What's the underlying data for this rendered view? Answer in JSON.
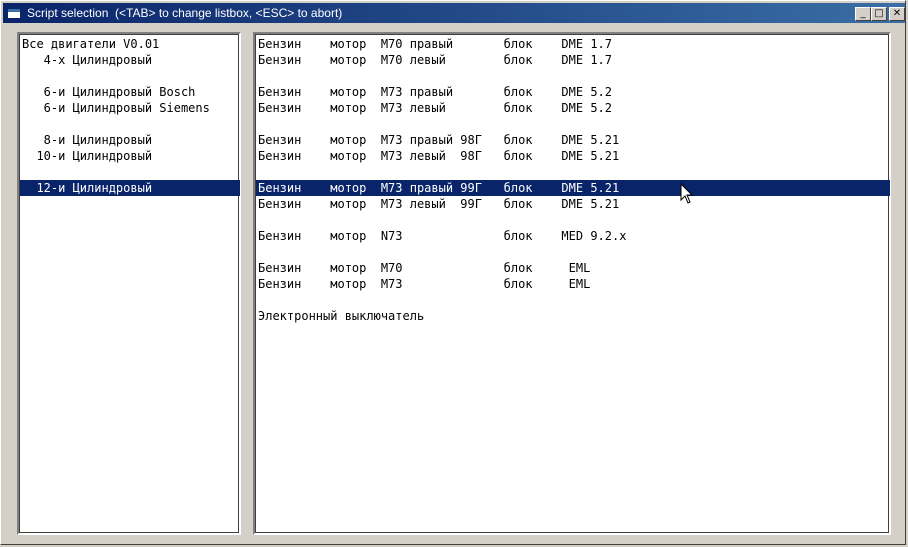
{
  "window": {
    "title": "Script selection  (<TAB> to change listbox, <ESC> to abort)",
    "buttons": {
      "minimize": "_",
      "maximize": "□",
      "close": "✕"
    }
  },
  "left_list": {
    "items": [
      "Все двигатели V0.01",
      "   4-х Цилиндровый",
      "",
      "   6-и Цилиндровый Bosch",
      "   6-и Цилиндровый Siemens",
      "",
      "   8-и Цилиндровый",
      "  10-и Цилиндровый",
      "",
      "  12-и Цилиндровый"
    ],
    "selected_index": 9
  },
  "right_list": {
    "items": [
      "Бензин    мотор  M70 правый       блок    DME 1.7",
      "Бензин    мотор  M70 левый        блок    DME 1.7",
      "",
      "Бензин    мотор  M73 правый       блок    DME 5.2",
      "Бензин    мотор  M73 левый        блок    DME 5.2",
      "",
      "Бензин    мотор  M73 правый 98Г   блок    DME 5.21",
      "Бензин    мотор  M73 левый  98Г   блок    DME 5.21",
      "",
      "Бензин    мотор  M73 правый 99Г   блок    DME 5.21",
      "Бензин    мотор  M73 левый  99Г   блок    DME 5.21",
      "",
      "Бензин    мотор  N73              блок    MED 9.2.x",
      "",
      "Бензин    мотор  M70              блок     EML",
      "Бензин    мотор  M73              блок     EML",
      "",
      "Электронный выключатель"
    ],
    "selected_index": 9
  },
  "icons": {
    "app": "window-icon",
    "pointer": "mouse-pointer-icon"
  },
  "colors": {
    "selection": "#0a246a",
    "titlebar_start": "#0a246a",
    "titlebar_end": "#3a6ea5",
    "window_face": "#d4d0c8"
  }
}
